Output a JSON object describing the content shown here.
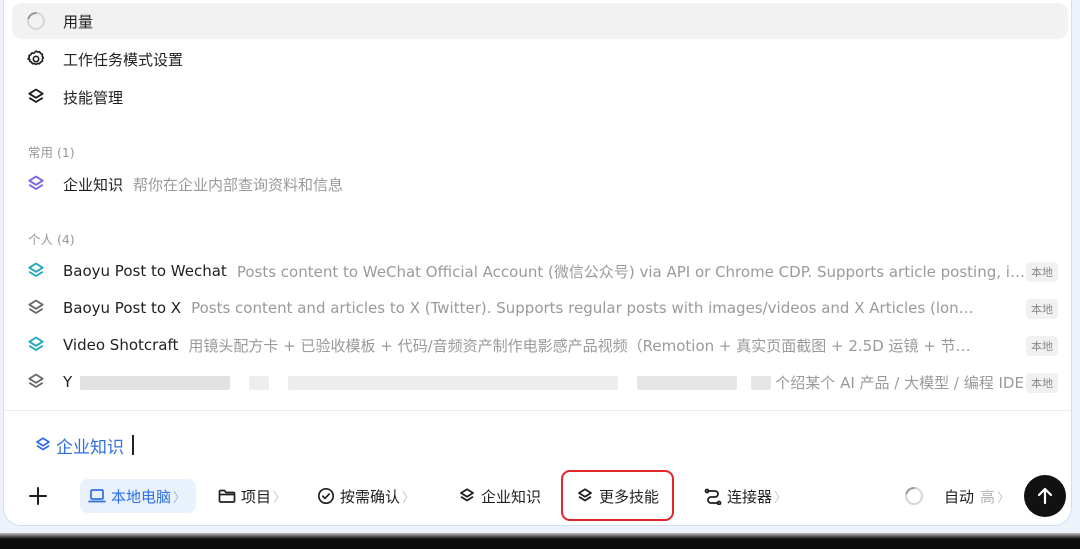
{
  "menu": {
    "usage": "用量",
    "work_mode_settings": "工作任务模式设置",
    "skill_management": "技能管理"
  },
  "sections": {
    "common": "常用 (1)",
    "personal": "个人 (4)"
  },
  "common_skills": [
    {
      "name": "企业知识",
      "desc": "帮你在企业内部查询资料和信息"
    }
  ],
  "personal_skills": [
    {
      "name": "Baoyu Post to Wechat",
      "desc": "Posts content to WeChat Official Account (微信公众号) via API or Chrome CDP. Supports article posting, image-text posting and more.",
      "badge": "本地",
      "icon_color": "#1fa8b8"
    },
    {
      "name": "Baoyu Post to X",
      "desc": "Posts content and articles to X (Twitter). Supports regular posts with images/videos and X Articles (long-form).",
      "badge": "本地",
      "icon_color": "#6b6b6b"
    },
    {
      "name": "Video Shotcraft",
      "desc": "用镜头配方卡 + 已验收模板 + 代码/音频资产制作电影感产品视频（Remotion + 真实页面截图 + 2.5D 运镜 + 节奏...",
      "badge": "本地",
      "icon_color": "#1fa8b8"
    },
    {
      "name": "Y",
      "desc": "个绍某个 AI 产品 / 大模型 / 编程 IDE ...",
      "badge": "本地",
      "icon_color": "#6b6b6b"
    }
  ],
  "input": {
    "chip": "企业知识"
  },
  "toolbar": {
    "local_computer": "本地电脑",
    "project": "项目",
    "confirm_on_demand": "按需确认",
    "enterprise_knowledge": "企业知识",
    "more_skills": "更多技能",
    "connectors": "连接器",
    "auto": "自动",
    "level": "高"
  },
  "colors": {
    "accent": "#2f6fe4",
    "highlight": "#e0252b",
    "skill_purple": "#7b61e8",
    "skill_teal": "#1fa8b8"
  }
}
